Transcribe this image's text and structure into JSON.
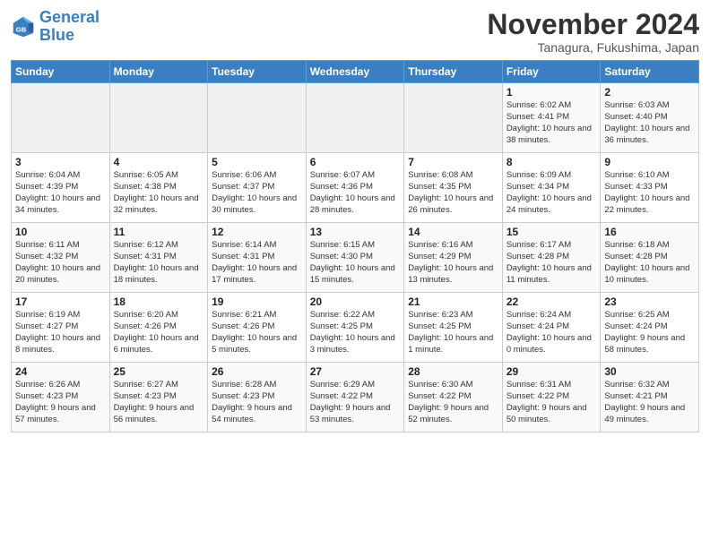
{
  "logo": {
    "line1": "General",
    "line2": "Blue"
  },
  "title": "November 2024",
  "location": "Tanagura, Fukushima, Japan",
  "weekdays": [
    "Sunday",
    "Monday",
    "Tuesday",
    "Wednesday",
    "Thursday",
    "Friday",
    "Saturday"
  ],
  "weeks": [
    [
      {
        "day": "",
        "info": ""
      },
      {
        "day": "",
        "info": ""
      },
      {
        "day": "",
        "info": ""
      },
      {
        "day": "",
        "info": ""
      },
      {
        "day": "",
        "info": ""
      },
      {
        "day": "1",
        "info": "Sunrise: 6:02 AM\nSunset: 4:41 PM\nDaylight: 10 hours and 38 minutes."
      },
      {
        "day": "2",
        "info": "Sunrise: 6:03 AM\nSunset: 4:40 PM\nDaylight: 10 hours and 36 minutes."
      }
    ],
    [
      {
        "day": "3",
        "info": "Sunrise: 6:04 AM\nSunset: 4:39 PM\nDaylight: 10 hours and 34 minutes."
      },
      {
        "day": "4",
        "info": "Sunrise: 6:05 AM\nSunset: 4:38 PM\nDaylight: 10 hours and 32 minutes."
      },
      {
        "day": "5",
        "info": "Sunrise: 6:06 AM\nSunset: 4:37 PM\nDaylight: 10 hours and 30 minutes."
      },
      {
        "day": "6",
        "info": "Sunrise: 6:07 AM\nSunset: 4:36 PM\nDaylight: 10 hours and 28 minutes."
      },
      {
        "day": "7",
        "info": "Sunrise: 6:08 AM\nSunset: 4:35 PM\nDaylight: 10 hours and 26 minutes."
      },
      {
        "day": "8",
        "info": "Sunrise: 6:09 AM\nSunset: 4:34 PM\nDaylight: 10 hours and 24 minutes."
      },
      {
        "day": "9",
        "info": "Sunrise: 6:10 AM\nSunset: 4:33 PM\nDaylight: 10 hours and 22 minutes."
      }
    ],
    [
      {
        "day": "10",
        "info": "Sunrise: 6:11 AM\nSunset: 4:32 PM\nDaylight: 10 hours and 20 minutes."
      },
      {
        "day": "11",
        "info": "Sunrise: 6:12 AM\nSunset: 4:31 PM\nDaylight: 10 hours and 18 minutes."
      },
      {
        "day": "12",
        "info": "Sunrise: 6:14 AM\nSunset: 4:31 PM\nDaylight: 10 hours and 17 minutes."
      },
      {
        "day": "13",
        "info": "Sunrise: 6:15 AM\nSunset: 4:30 PM\nDaylight: 10 hours and 15 minutes."
      },
      {
        "day": "14",
        "info": "Sunrise: 6:16 AM\nSunset: 4:29 PM\nDaylight: 10 hours and 13 minutes."
      },
      {
        "day": "15",
        "info": "Sunrise: 6:17 AM\nSunset: 4:28 PM\nDaylight: 10 hours and 11 minutes."
      },
      {
        "day": "16",
        "info": "Sunrise: 6:18 AM\nSunset: 4:28 PM\nDaylight: 10 hours and 10 minutes."
      }
    ],
    [
      {
        "day": "17",
        "info": "Sunrise: 6:19 AM\nSunset: 4:27 PM\nDaylight: 10 hours and 8 minutes."
      },
      {
        "day": "18",
        "info": "Sunrise: 6:20 AM\nSunset: 4:26 PM\nDaylight: 10 hours and 6 minutes."
      },
      {
        "day": "19",
        "info": "Sunrise: 6:21 AM\nSunset: 4:26 PM\nDaylight: 10 hours and 5 minutes."
      },
      {
        "day": "20",
        "info": "Sunrise: 6:22 AM\nSunset: 4:25 PM\nDaylight: 10 hours and 3 minutes."
      },
      {
        "day": "21",
        "info": "Sunrise: 6:23 AM\nSunset: 4:25 PM\nDaylight: 10 hours and 1 minute."
      },
      {
        "day": "22",
        "info": "Sunrise: 6:24 AM\nSunset: 4:24 PM\nDaylight: 10 hours and 0 minutes."
      },
      {
        "day": "23",
        "info": "Sunrise: 6:25 AM\nSunset: 4:24 PM\nDaylight: 9 hours and 58 minutes."
      }
    ],
    [
      {
        "day": "24",
        "info": "Sunrise: 6:26 AM\nSunset: 4:23 PM\nDaylight: 9 hours and 57 minutes."
      },
      {
        "day": "25",
        "info": "Sunrise: 6:27 AM\nSunset: 4:23 PM\nDaylight: 9 hours and 56 minutes."
      },
      {
        "day": "26",
        "info": "Sunrise: 6:28 AM\nSunset: 4:23 PM\nDaylight: 9 hours and 54 minutes."
      },
      {
        "day": "27",
        "info": "Sunrise: 6:29 AM\nSunset: 4:22 PM\nDaylight: 9 hours and 53 minutes."
      },
      {
        "day": "28",
        "info": "Sunrise: 6:30 AM\nSunset: 4:22 PM\nDaylight: 9 hours and 52 minutes."
      },
      {
        "day": "29",
        "info": "Sunrise: 6:31 AM\nSunset: 4:22 PM\nDaylight: 9 hours and 50 minutes."
      },
      {
        "day": "30",
        "info": "Sunrise: 6:32 AM\nSunset: 4:21 PM\nDaylight: 9 hours and 49 minutes."
      }
    ]
  ]
}
